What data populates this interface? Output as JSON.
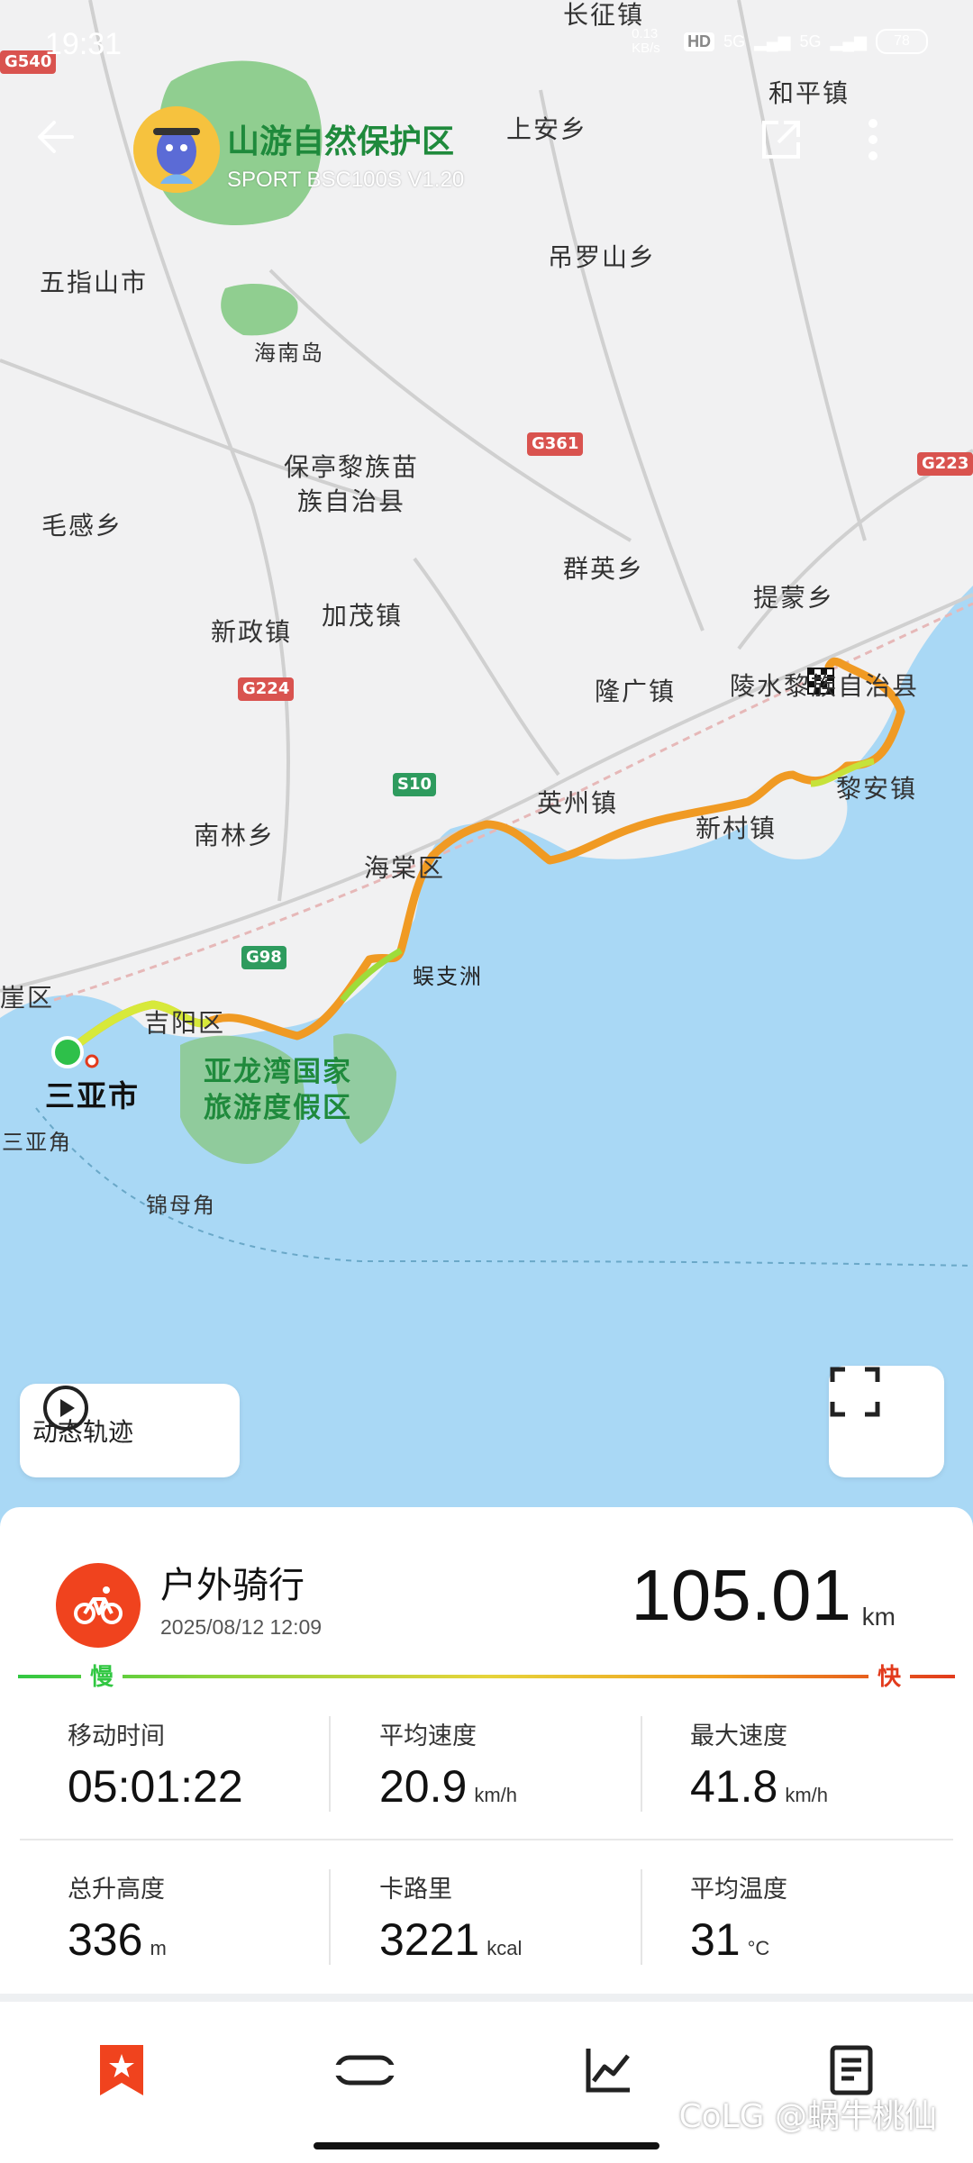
{
  "status_bar": {
    "time": "19:31",
    "net_speed": "0.13 KB/s",
    "hd": "HD",
    "signal1": "5G",
    "signal2": "5G",
    "battery": "78"
  },
  "header": {
    "title": "山游自然保护区",
    "device": "SPORT BSC100S  V1.20"
  },
  "map": {
    "places": {
      "changzheng": "长征镇",
      "heping": "和平镇",
      "shangan": "上安乡",
      "wuzhishan": "五指山市",
      "diaoluoshan": "吊罗山乡",
      "hainandao": "海南岛",
      "baoting": "保亭黎族苗\n族自治县",
      "maogan": "毛感乡",
      "qunying": "群英乡",
      "timeng": "提蒙乡",
      "xinzheng": "新政镇",
      "jiamao": "加茂镇",
      "longguang": "隆广镇",
      "lingshui": "陵水黎族自治县",
      "yingzhou": "英州镇",
      "lian": "黎安镇",
      "nanlin": "南林乡",
      "haitang": "海棠区",
      "xincun": "新村镇",
      "wuzhizhou": "蜈支洲",
      "yazhou": "崖区",
      "jiyang": "吉阳区",
      "sanya": "三亚市",
      "yalongwan": "亚龙湾国家\n旅游度假区",
      "sanyajiao": "三亚角",
      "jinmujiao": "锦母角"
    },
    "roads": {
      "g540": "G540",
      "g361": "G361",
      "g223": "G223",
      "g224": "G224",
      "s10": "S10",
      "g98": "G98"
    },
    "dynamic_track_label": "动态轨迹"
  },
  "activity": {
    "type": "户外骑行",
    "datetime": "2025/08/12 12:09",
    "distance": "105.01",
    "distance_unit": "km",
    "slow_label": "慢",
    "fast_label": "快"
  },
  "stats": [
    {
      "label": "移动时间",
      "value": "05:01:22",
      "unit": ""
    },
    {
      "label": "平均速度",
      "value": "20.9",
      "unit": "km/h"
    },
    {
      "label": "最大速度",
      "value": "41.8",
      "unit": "km/h"
    },
    {
      "label": "总升高度",
      "value": "336",
      "unit": "m"
    },
    {
      "label": "卡路里",
      "value": "3221",
      "unit": "kcal"
    },
    {
      "label": "平均温度",
      "value": "31",
      "unit": "°C"
    }
  ],
  "watermark": "CoLG @蜗牛桃仙",
  "colors": {
    "accent": "#f0431e",
    "slow": "#31c742",
    "fast": "#e23a1c",
    "sea": "#a9d8f5",
    "park_green": "#7fc87f"
  }
}
